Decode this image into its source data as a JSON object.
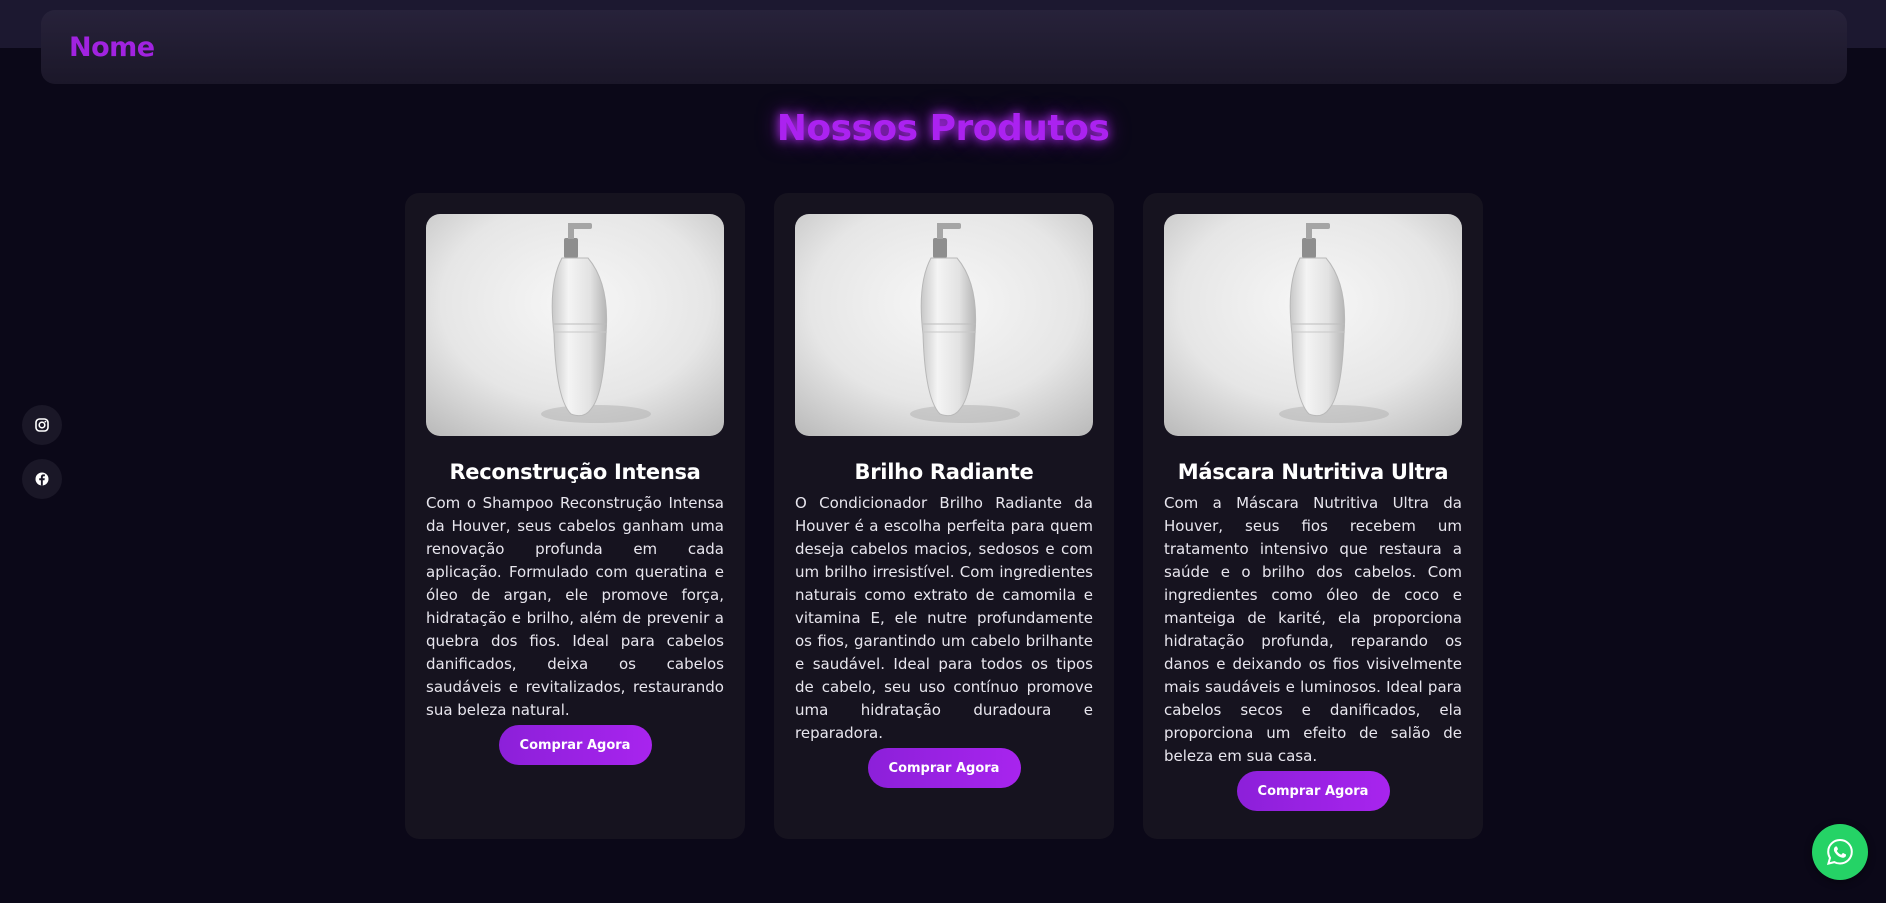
{
  "header": {
    "brand": "Nome"
  },
  "products_section": {
    "title": "Nossos Produtos",
    "products": [
      {
        "name": "Reconstrução Intensa",
        "description": "Com o Shampoo Reconstrução Intensa da Houver, seus cabelos ganham uma renovação profunda em cada aplicação. Formulado com queratina e óleo de argan, ele promove força, hidratação e brilho, além de prevenir a quebra dos fios. Ideal para cabelos danificados, deixa os cabelos saudáveis e revitalizados, restaurando sua beleza natural.",
        "button_label": "Comprar Agora"
      },
      {
        "name": "Brilho Radiante",
        "description": "O Condicionador Brilho Radiante da Houver é a escolha perfeita para quem deseja cabelos macios, sedosos e com um brilho irresistível. Com ingredientes naturais como extrato de camomila e vitamina E, ele nutre profundamente os fios, garantindo um cabelo brilhante e saudável. Ideal para todos os tipos de cabelo, seu uso contínuo promove uma hidratação duradoura e reparadora.",
        "button_label": "Comprar Agora"
      },
      {
        "name": "Máscara Nutritiva Ultra",
        "description": "Com a Máscara Nutritiva Ultra da Houver, seus fios recebem um tratamento intensivo que restaura a saúde e o brilho dos cabelos. Com ingredientes como óleo de coco e manteiga de karité, ela proporciona hidratação profunda, reparando os danos e deixando os fios visivelmente mais saudáveis e luminosos. Ideal para cabelos secos e danificados, ela proporciona um efeito de salão de beleza em sua casa.",
        "button_label": "Comprar Agora"
      }
    ]
  },
  "social_links": [
    {
      "icon": "instagram-icon"
    },
    {
      "icon": "facebook-icon"
    }
  ],
  "floating": {
    "icon": "whatsapp-icon"
  },
  "colors": {
    "background": "#0b0818",
    "accent": "#a123e0",
    "card": "#16131f",
    "whatsapp": "#25d366"
  }
}
